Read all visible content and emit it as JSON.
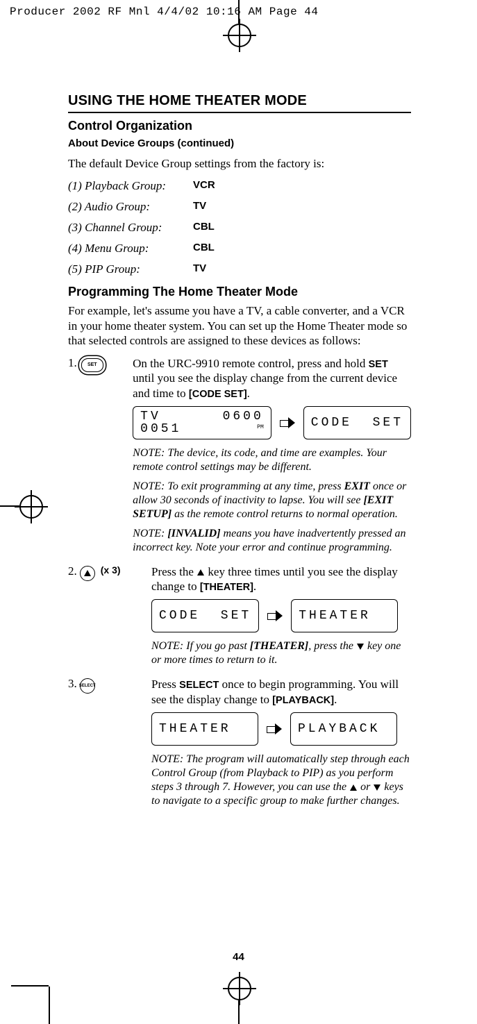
{
  "printer_header": "Producer 2002 RF Mnl  4/4/02  10:16 AM  Page 44",
  "h1": "USING THE HOME THEATER MODE",
  "h2": "Control Organization",
  "h3": "About Device Groups (continued)",
  "intro": "The default Device Group settings from the factory is:",
  "factory": [
    {
      "label": "(1) Playback Group:",
      "value": "VCR"
    },
    {
      "label": "(2) Audio Group:",
      "value": "TV"
    },
    {
      "label": "(3) Channel Group:",
      "value": "CBL"
    },
    {
      "label": "(4) Menu Group:",
      "value": "CBL"
    },
    {
      "label": "(5) PIP Group:",
      "value": "TV"
    }
  ],
  "h2b": "Programming The Home Theater Mode",
  "p_example": "For example, let's assume you have a TV, a cable converter, and a VCR in your home theater system. You can set up the Home Theater mode so that selected controls are assigned to these devices as follows:",
  "steps": {
    "s1": {
      "num": "1.",
      "btn": "SET",
      "text_a": "On the URC-9910 remote control, press and hold ",
      "text_b": "SET",
      "text_c": " until you see the display change from the current device and time to ",
      "text_d": "[CODE SET]",
      "text_e": ".",
      "lcd_from_top": "TV      0600",
      "lcd_from_bot": "0051",
      "lcd_from_pm": "PM",
      "lcd_to": "CODE  SET",
      "note1": "NOTE: The device, its code, and time are examples. Your remote control settings may be different.",
      "note2_a": "NOTE: To exit programming at any time, press ",
      "note2_b": "EXIT",
      "note2_c": " once or allow 30 seconds of inactivity to lapse. You will see ",
      "note2_d": "[EXIT SETUP]",
      "note2_e": " as the remote control returns to normal operation.",
      "note3_a": "NOTE: ",
      "note3_b": "[INVALID]",
      "note3_c": " means you have inadvertently pressed an incorrect key. Note your error and continue programming."
    },
    "s2": {
      "num": "2.",
      "x3": "(x 3)",
      "text_a": "Press the ",
      "text_b": " key three times until you see the display change to ",
      "text_c": "[THEATER]",
      "text_d": ".",
      "lcd_from": "CODE  SET",
      "lcd_to": "THEATER",
      "note_a": "NOTE: If you go past ",
      "note_b": "[THEATER]",
      "note_c": ", press the ",
      "note_d": " key one or more times to return to it."
    },
    "s3": {
      "num": "3.",
      "btn": "SELECT",
      "text_a": "Press ",
      "text_b": "SELECT",
      "text_c": " once to begin programming. You will see the display change to ",
      "text_d": "[PLAYBACK]",
      "text_e": ".",
      "lcd_from": "THEATER",
      "lcd_to": "PLAYBACK",
      "note_a": "NOTE: The program will automatically step through each Control Group (from Playback to PIP) as you perform steps 3 through 7. However, you can use the ",
      "note_b": " or ",
      "note_c": " keys to navigate to a specific group to make further changes."
    }
  },
  "page_num": "44"
}
